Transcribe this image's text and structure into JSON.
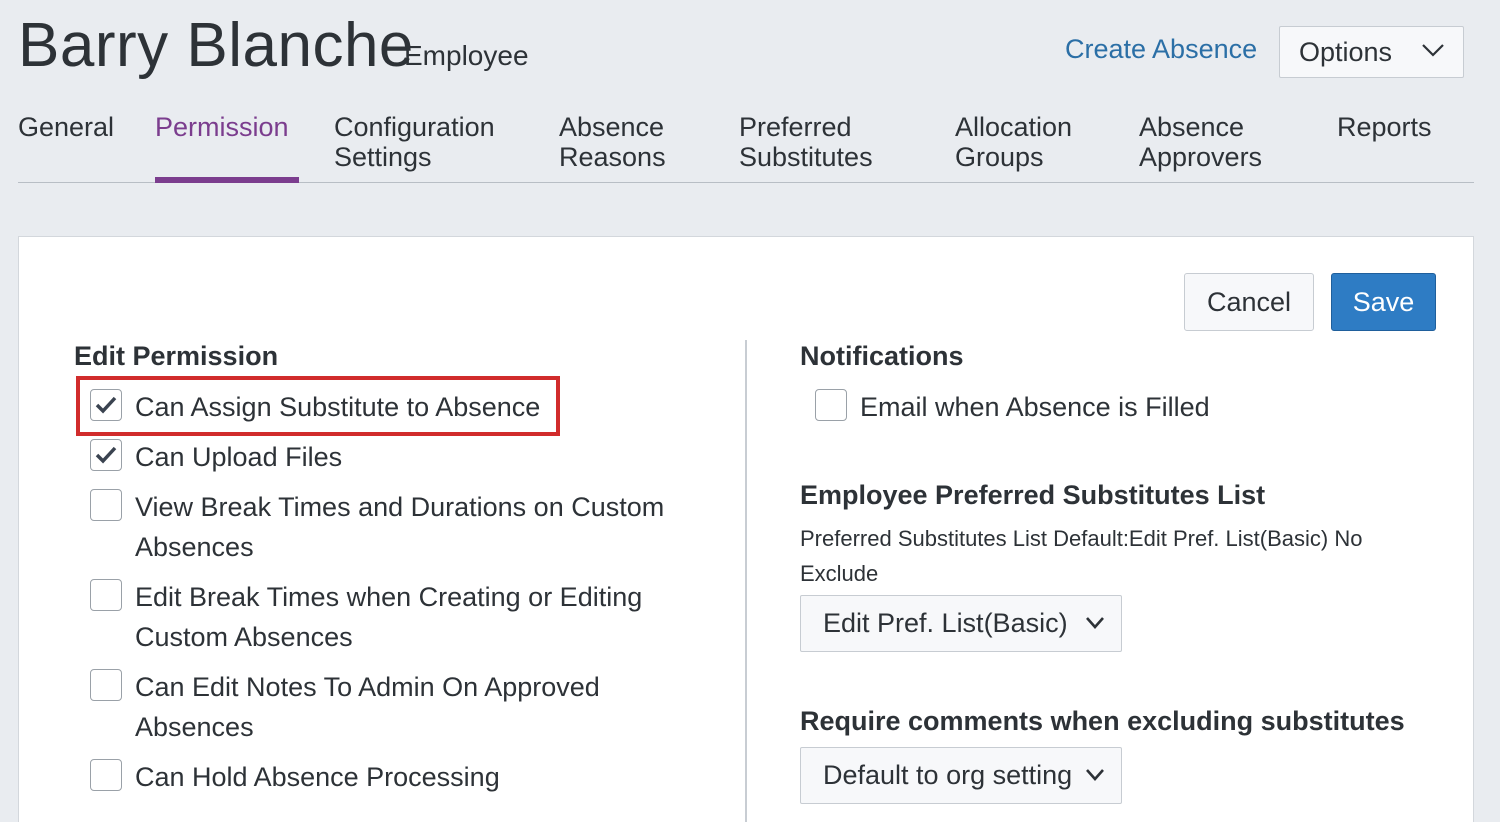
{
  "header": {
    "employee_name": "Barry Blanche",
    "employee_role": "Employee",
    "create_absence_label": "Create Absence",
    "options_label": "Options"
  },
  "tabs": [
    {
      "line1": "General",
      "line2": "",
      "active": false
    },
    {
      "line1": "Permission",
      "line2": "",
      "active": true
    },
    {
      "line1": "Configuration",
      "line2": "Settings",
      "active": false
    },
    {
      "line1": "Absence",
      "line2": "Reasons",
      "active": false
    },
    {
      "line1": "Preferred",
      "line2": "Substitutes",
      "active": false
    },
    {
      "line1": "Allocation",
      "line2": "Groups",
      "active": false
    },
    {
      "line1": "Absence",
      "line2": "Approvers",
      "active": false
    },
    {
      "line1": "Reports",
      "line2": "",
      "active": false
    }
  ],
  "actions": {
    "cancel_label": "Cancel",
    "save_label": "Save"
  },
  "permissions": {
    "title": "Edit Permission",
    "items": [
      {
        "label": "Can Assign Substitute to Absence",
        "checked": true
      },
      {
        "label": "Can Upload Files",
        "checked": true
      },
      {
        "label": "View Break Times and Durations on Custom Absences",
        "checked": false
      },
      {
        "label": "Edit Break Times when Creating or Editing Custom Absences",
        "checked": false
      },
      {
        "label": "Can Edit Notes To Admin On Approved Absences",
        "checked": false
      },
      {
        "label": "Can Hold Absence Processing",
        "checked": false
      }
    ]
  },
  "notifications": {
    "title": "Notifications",
    "email_filled_label": "Email when Absence is Filled",
    "email_filled_checked": false
  },
  "preferred_list": {
    "title": "Employee Preferred Substitutes List",
    "default_note": "Preferred Substitutes List Default:Edit Pref. List(Basic) No Exclude",
    "selected": "Edit Pref. List(Basic)"
  },
  "require_comments": {
    "title": "Require comments when excluding substitutes",
    "selected": "Default to org setting"
  },
  "colors": {
    "accent": "#7b3d8e",
    "link": "#2b6fa6",
    "save": "#2e7cc4",
    "highlight": "#d12c2c"
  }
}
